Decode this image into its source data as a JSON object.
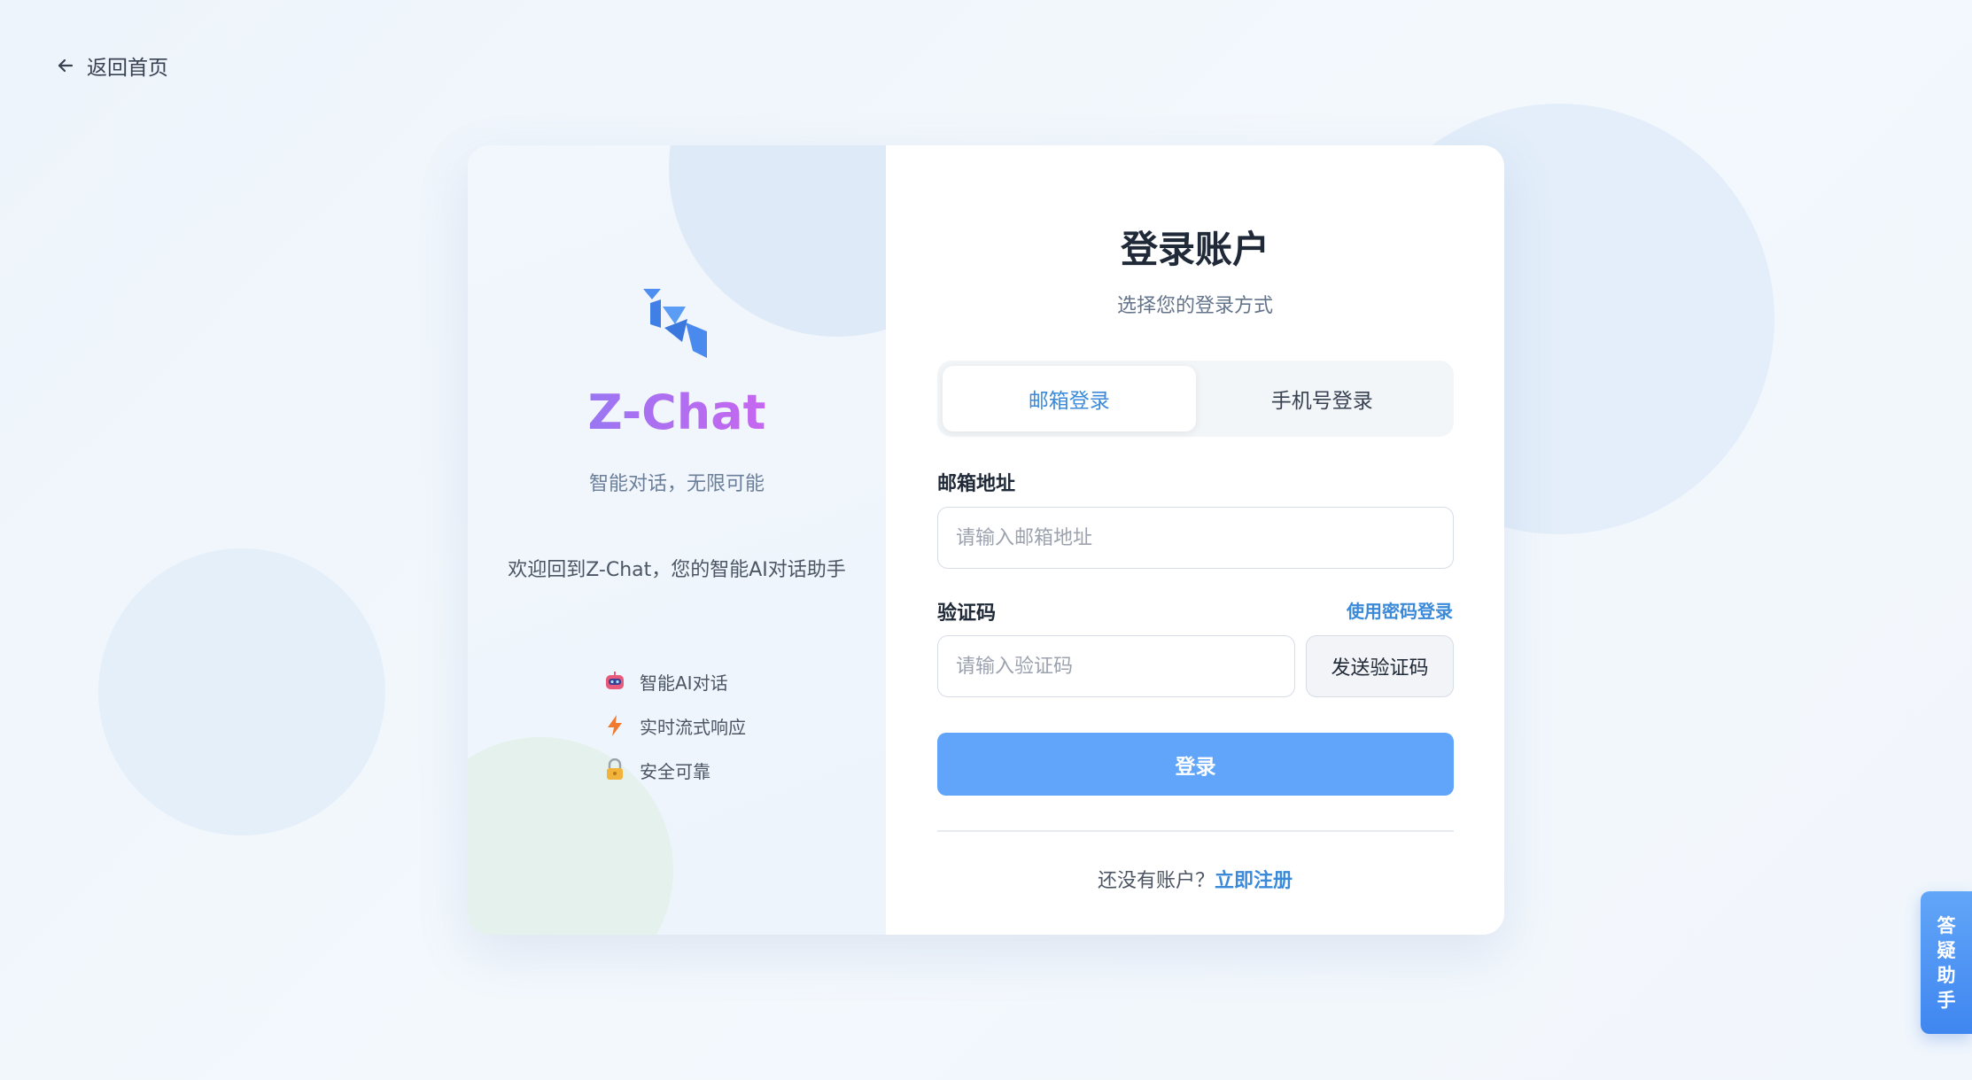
{
  "nav": {
    "back_label": "返回首页",
    "back_icon": "arrow-left-icon"
  },
  "brand": {
    "name": "Z-Chat",
    "tagline": "智能对话，无限可能",
    "welcome": "欢迎回到Z-Chat，您的智能AI对话助手",
    "features": [
      {
        "icon": "robot-icon",
        "label": "智能AI对话"
      },
      {
        "icon": "lightning-icon",
        "label": "实时流式响应"
      },
      {
        "icon": "lock-icon",
        "label": "安全可靠"
      }
    ]
  },
  "login": {
    "title": "登录账户",
    "subtitle": "选择您的登录方式",
    "tabs": [
      {
        "label": "邮箱登录",
        "active": true
      },
      {
        "label": "手机号登录",
        "active": false
      }
    ],
    "email_label": "邮箱地址",
    "email_placeholder": "请输入邮箱地址",
    "code_label": "验证码",
    "password_login_link": "使用密码登录",
    "code_placeholder": "请输入验证码",
    "send_code_button": "发送验证码",
    "submit_button": "登录",
    "signup_prompt": "还没有账户？",
    "signup_link": "立即注册"
  },
  "helper": {
    "chars": [
      "答",
      "疑",
      "助",
      "手"
    ]
  },
  "colors": {
    "accent": "#3b8ad9",
    "primary_button": "#60a5f9",
    "helper": "#4a8ff3"
  }
}
